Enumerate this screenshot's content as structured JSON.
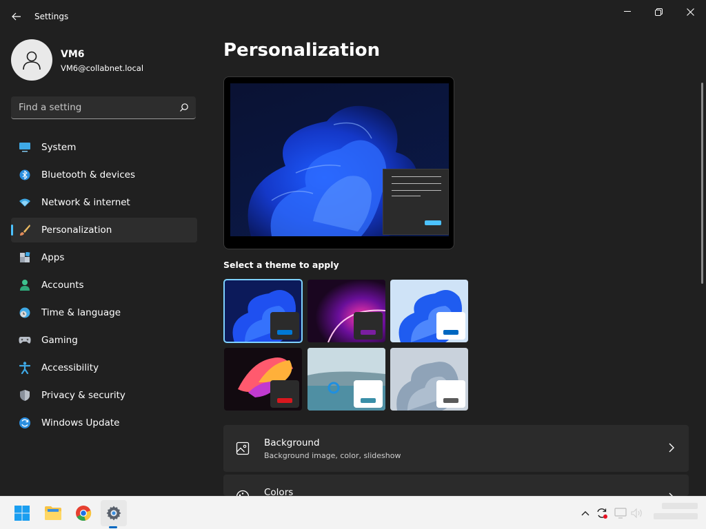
{
  "window": {
    "app_title": "Settings",
    "page_title": "Personalization"
  },
  "profile": {
    "name": "VM6",
    "email": "VM6@collabnet.local"
  },
  "search": {
    "placeholder": "Find a setting"
  },
  "nav": [
    {
      "label": "System",
      "icon": "monitor-icon",
      "active": false
    },
    {
      "label": "Bluetooth & devices",
      "icon": "bluetooth-icon",
      "active": false
    },
    {
      "label": "Network & internet",
      "icon": "wifi-icon",
      "active": false
    },
    {
      "label": "Personalization",
      "icon": "brush-icon",
      "active": true
    },
    {
      "label": "Apps",
      "icon": "apps-icon",
      "active": false
    },
    {
      "label": "Accounts",
      "icon": "person-icon",
      "active": false
    },
    {
      "label": "Time & language",
      "icon": "clock-globe-icon",
      "active": false
    },
    {
      "label": "Gaming",
      "icon": "gamepad-icon",
      "active": false
    },
    {
      "label": "Accessibility",
      "icon": "accessibility-icon",
      "active": false
    },
    {
      "label": "Privacy & security",
      "icon": "shield-icon",
      "active": false
    },
    {
      "label": "Windows Update",
      "icon": "update-icon",
      "active": false
    }
  ],
  "themes": {
    "label": "Select a theme to apply",
    "items": [
      {
        "name": "windows-dark",
        "selected": true,
        "bar_color": "#0078d4",
        "card_color": "#2b2b2b"
      },
      {
        "name": "glow",
        "selected": false,
        "bar_color": "#7a1ea0",
        "card_color": "#2b2b2b"
      },
      {
        "name": "windows-light",
        "selected": false,
        "bar_color": "#0067c0",
        "card_color": "#ffffff"
      },
      {
        "name": "captured-motion",
        "selected": false,
        "bar_color": "#d9171e",
        "card_color": "#2b2b2b"
      },
      {
        "name": "flow",
        "selected": false,
        "bar_color": "#3a8fa8",
        "card_color": "#ffffff"
      },
      {
        "name": "sunrise",
        "selected": false,
        "bar_color": "#5a5a5a",
        "card_color": "#ffffff"
      }
    ]
  },
  "cards": [
    {
      "title": "Background",
      "subtitle": "Background image, color, slideshow",
      "icon": "image-icon"
    },
    {
      "title": "Colors",
      "subtitle": "",
      "icon": "palette-icon"
    }
  ],
  "colors": {
    "accent": "#4cc2ff",
    "background": "#202020",
    "card": "#2b2b2b"
  }
}
